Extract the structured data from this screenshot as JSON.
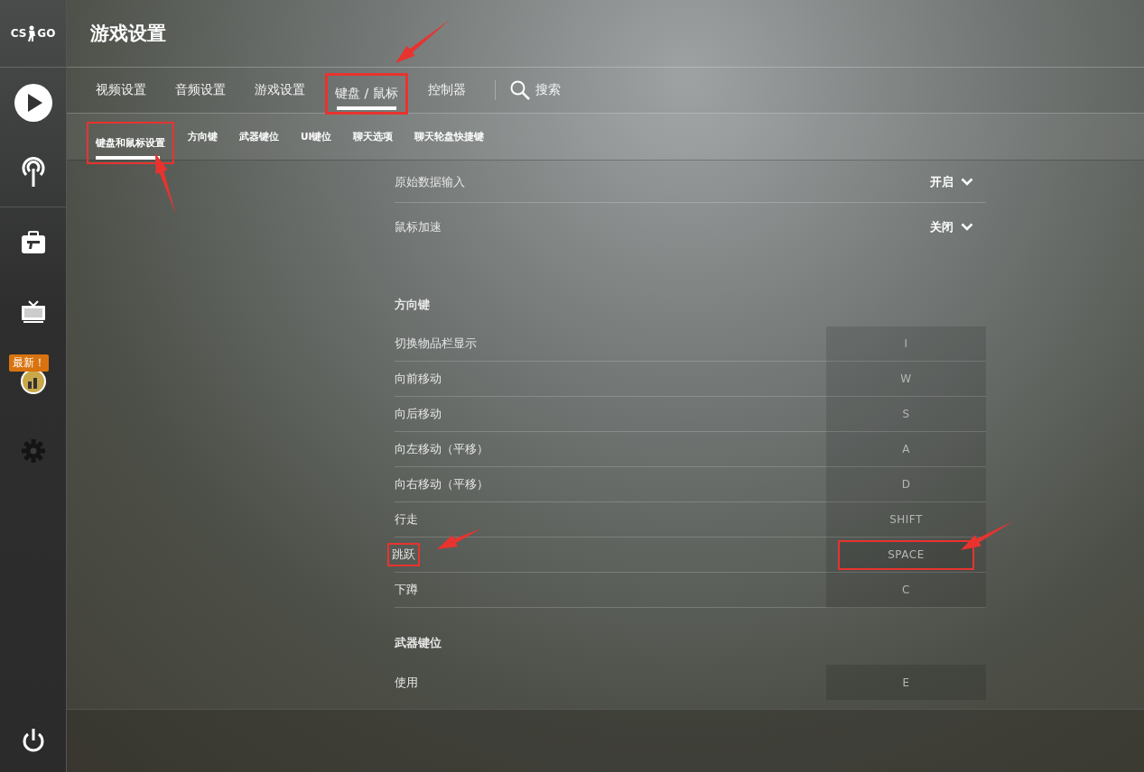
{
  "sidebar": {
    "logo": [
      "CS",
      "GO"
    ],
    "items": [
      {
        "kind": "play",
        "selected": false
      },
      {
        "kind": "antenna",
        "selected": false
      },
      {
        "kind": "briefcase",
        "selected": false
      },
      {
        "kind": "tv",
        "selected": false
      },
      {
        "kind": "coin",
        "selected": false,
        "badge": "最新！"
      },
      {
        "kind": "gear",
        "selected": true
      }
    ],
    "power": {
      "kind": "power"
    }
  },
  "header": {
    "title": "游戏设置"
  },
  "tabs": [
    {
      "label": "视频设置",
      "selected": false,
      "highlighted": false
    },
    {
      "label": "音频设置",
      "selected": false,
      "highlighted": false
    },
    {
      "label": "游戏设置",
      "selected": false,
      "highlighted": false
    },
    {
      "label": "键盘 / 鼠标",
      "selected": true,
      "highlighted": true
    },
    {
      "label": "控制器",
      "selected": false,
      "highlighted": false
    }
  ],
  "search": {
    "label": "搜索"
  },
  "subtabs": [
    {
      "label": "键盘和鼠标设置",
      "selected": true,
      "highlighted": true
    },
    {
      "label": "方向键",
      "selected": false,
      "highlighted": false
    },
    {
      "label": "武器键位",
      "selected": false,
      "highlighted": false
    },
    {
      "label": "UI键位",
      "selected": false,
      "highlighted": false
    },
    {
      "label": "聊天选项",
      "selected": false,
      "highlighted": false
    },
    {
      "label": "聊天轮盘快捷键",
      "selected": false,
      "highlighted": false
    }
  ],
  "sections": [
    {
      "rows": [
        {
          "kind": "dropdown",
          "label": "原始数据输入",
          "value": "开启"
        },
        {
          "kind": "dropdown",
          "label": "鼠标加速",
          "value": "关闭"
        }
      ]
    },
    {
      "title": "方向键",
      "rows": [
        {
          "kind": "binding",
          "label": "切换物品栏显示",
          "key": "I",
          "highlighted": false
        },
        {
          "kind": "binding",
          "label": "向前移动",
          "key": "W",
          "highlighted": false
        },
        {
          "kind": "binding",
          "label": "向后移动",
          "key": "S",
          "highlighted": false
        },
        {
          "kind": "binding",
          "label": "向左移动（平移）",
          "key": "A",
          "highlighted": false
        },
        {
          "kind": "binding",
          "label": "向右移动（平移）",
          "key": "D",
          "highlighted": false
        },
        {
          "kind": "binding",
          "label": "行走",
          "key": "SHIFT",
          "highlighted": false
        },
        {
          "kind": "binding",
          "label": "跳跃",
          "key": "SPACE",
          "highlighted": true
        },
        {
          "kind": "binding",
          "label": "下蹲",
          "key": "C",
          "highlighted": false
        }
      ]
    },
    {
      "title": "武器键位",
      "rows": [
        {
          "kind": "binding",
          "label": "使用",
          "key": "E",
          "highlighted": false
        }
      ]
    }
  ]
}
